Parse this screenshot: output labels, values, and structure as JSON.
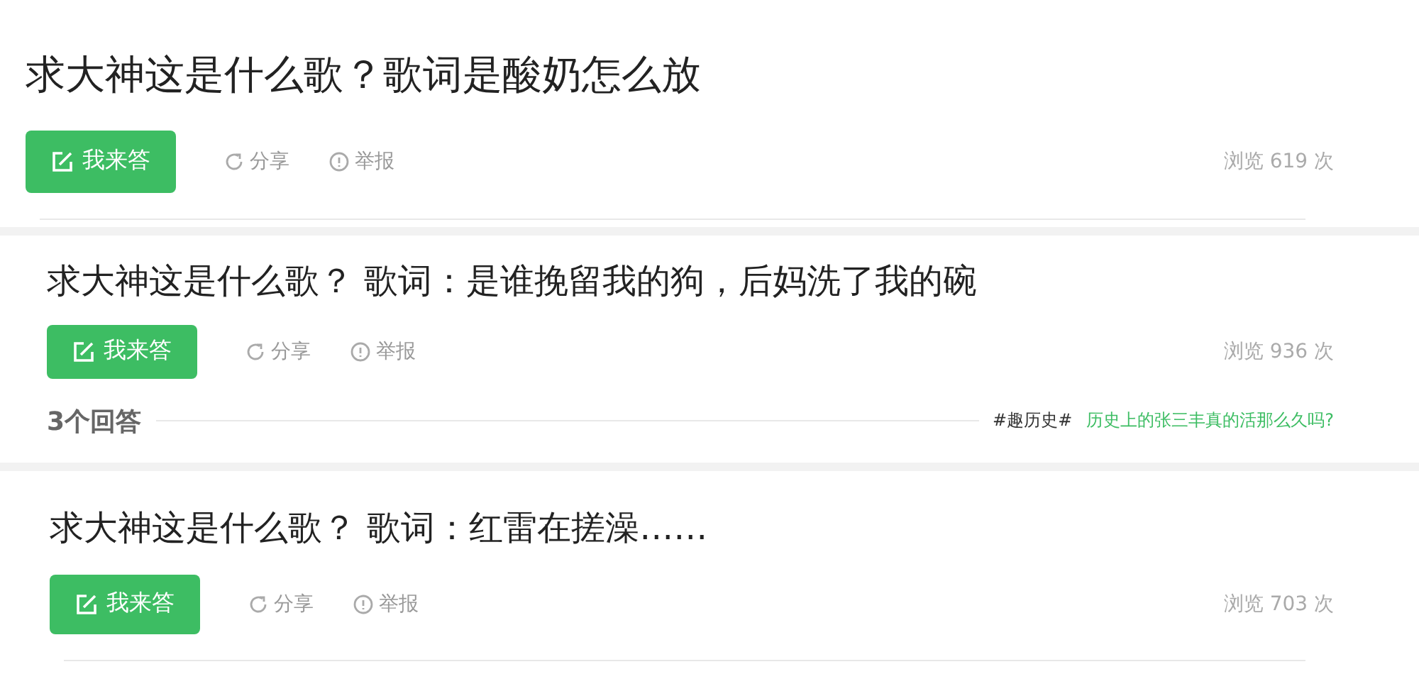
{
  "questions": [
    {
      "title": "求大神这是什么歌？歌词是酸奶怎么放",
      "answer_button": "我来答",
      "share": "分享",
      "report": "举报",
      "views": "浏览 619 次"
    },
    {
      "title": "求大神这是什么歌？ 歌词：是谁挽留我的狗，后妈洗了我的碗",
      "answer_button": "我来答",
      "share": "分享",
      "report": "举报",
      "views": "浏览 936 次",
      "answers_count": "3个回答",
      "topic_tag": "#趣历史#",
      "topic_link": "历史上的张三丰真的活那么久吗?"
    },
    {
      "title": "求大神这是什么歌？ 歌词：红雷在搓澡……",
      "answer_button": "我来答",
      "share": "分享",
      "report": "举报",
      "views": "浏览 703 次"
    }
  ]
}
